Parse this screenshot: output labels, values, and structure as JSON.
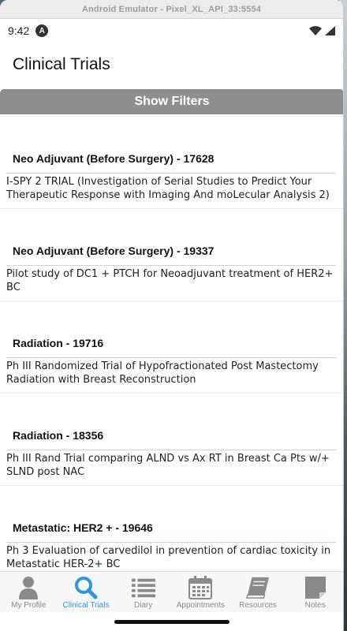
{
  "window": {
    "title": "Android Emulator - Pixel_XL_API_33:5554"
  },
  "status": {
    "time": "9:42",
    "app_badge": "A"
  },
  "page": {
    "title": "Clinical Trials"
  },
  "filters": {
    "button_label": "Show Filters"
  },
  "trials": [
    {
      "heading": "Neo Adjuvant (Before Surgery) - 17628",
      "description": "I-SPY 2 TRIAL (Investigation of Serial Studies to Predict Your Therapeutic Response with Imaging And moLecular Analysis 2)"
    },
    {
      "heading": "Neo Adjuvant (Before Surgery) - 19337",
      "description": "Pilot study of DC1 + PTCH for Neoadjuvant treatment of HER2+ BC"
    },
    {
      "heading": "Radiation  - 19716",
      "description": "Ph III Randomized Trial of Hypofractionated Post Mastectomy Radiation with Breast Reconstruction"
    },
    {
      "heading": "Radiation  - 18356",
      "description": "Ph III Rand Trial comparing ALND vs Ax RT in Breast Ca Pts w/+ SLND post NAC"
    },
    {
      "heading": "Metastatic: HER2 + - 19646",
      "description": "Ph 3 Evaluation of carvedilol in prevention of cardiac toxicity in Metastatic HER-2+ BC"
    }
  ],
  "tabs": [
    {
      "label": "My Profile",
      "icon": "person-icon"
    },
    {
      "label": "Clinical Trials",
      "icon": "search-icon",
      "active": true
    },
    {
      "label": "Diary",
      "icon": "list-icon"
    },
    {
      "label": "Appointments",
      "icon": "calendar-icon"
    },
    {
      "label": "Resources",
      "icon": "book-icon"
    },
    {
      "label": "Notes",
      "icon": "note-icon"
    }
  ],
  "colors": {
    "accent": "#2a96e4",
    "inactive": "#8a8a8a",
    "filter_button": "#8e8e8e"
  }
}
